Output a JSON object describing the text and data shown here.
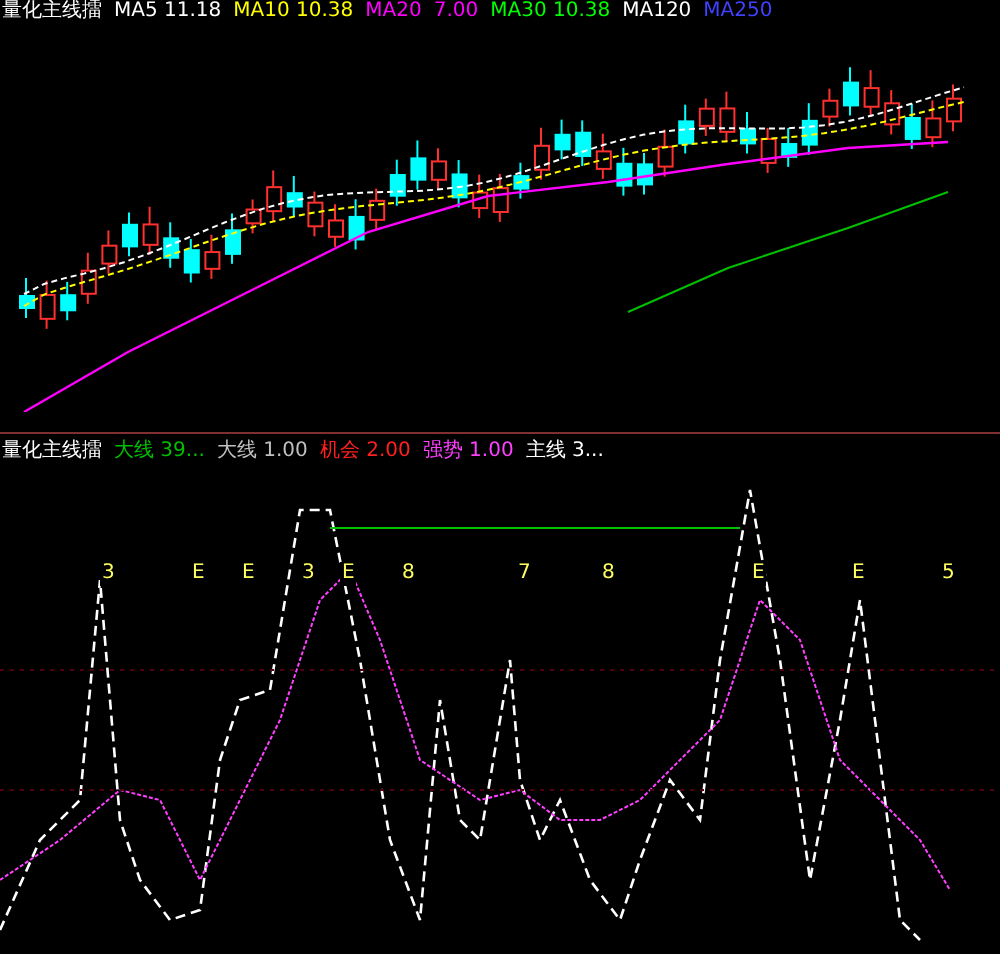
{
  "main_chart": {
    "title": "量化主线擂",
    "legend": [
      {
        "text": "MA5 11.18",
        "color": "#ffffff"
      },
      {
        "text": "MA10 10.38",
        "color": "#ffff00"
      },
      {
        "text": "MA20",
        "color": "#ff00ff"
      },
      {
        "text": "7.00",
        "color": "#ff00ff"
      },
      {
        "text": "MA30 10.38",
        "color": "#00ff00"
      },
      {
        "text": "MA120",
        "color": "#ffffff"
      },
      {
        "text": "MA250",
        "color": "#4040ff"
      }
    ]
  },
  "indicator": {
    "title": "量化主线擂",
    "legend": [
      {
        "text": "大线 39...",
        "color": "#00c000"
      },
      {
        "text": "大线 1.00",
        "color": "#c0c0c0"
      },
      {
        "text": "机会 2.00",
        "color": "#ff2020"
      },
      {
        "text": "强势 1.00",
        "color": "#ff40ff"
      },
      {
        "text": "主线 3...",
        "color": "#ffffff"
      }
    ],
    "markers": [
      "3",
      "E",
      "E",
      "3",
      "E",
      "8",
      "7",
      "8",
      "E",
      "E",
      "5"
    ]
  }
}
